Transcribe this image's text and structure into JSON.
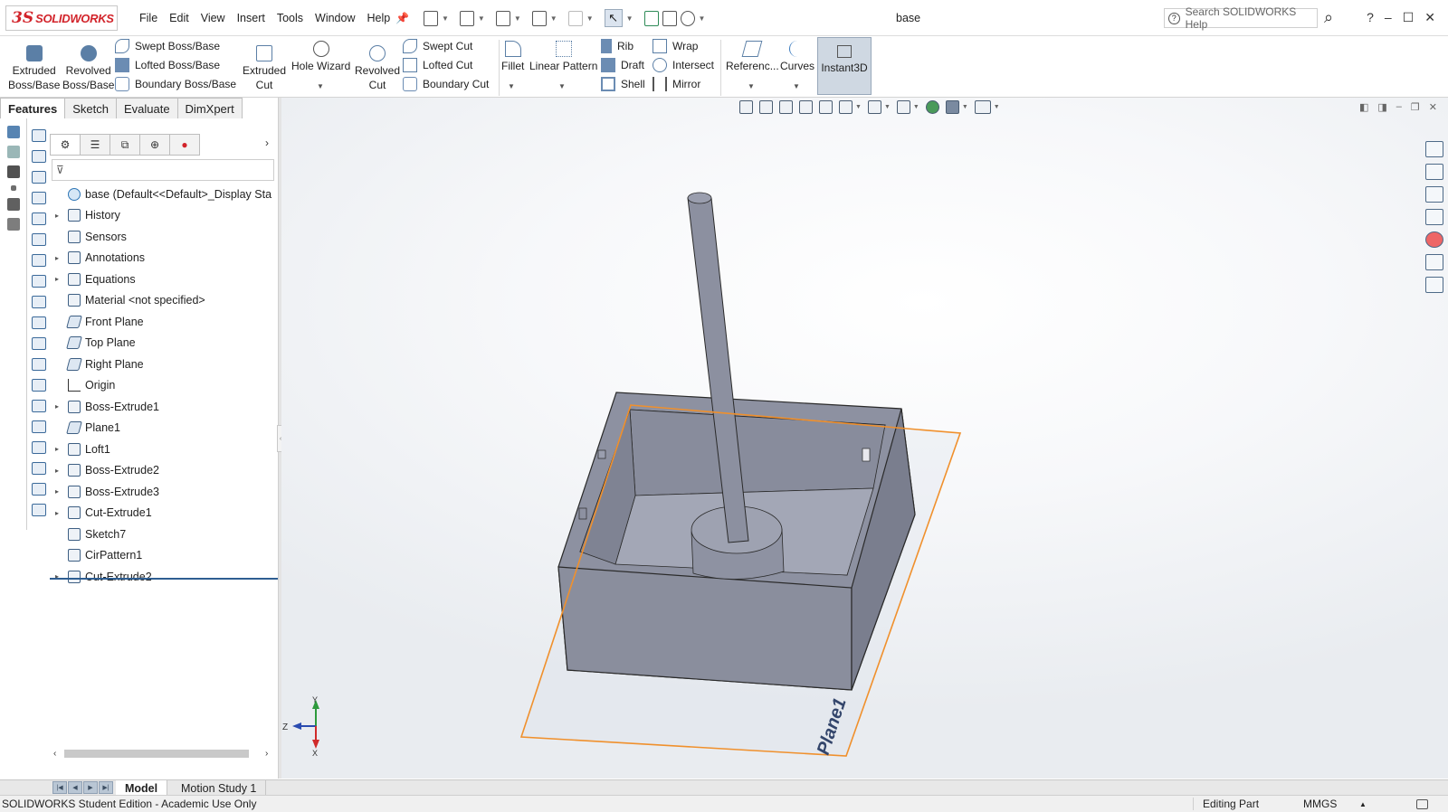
{
  "app": {
    "logo": {
      "mark": "3S",
      "name": "SOLIDWORKS"
    },
    "menu": [
      "File",
      "Edit",
      "View",
      "Insert",
      "Tools",
      "Window",
      "Help"
    ],
    "document_title": "base",
    "help_search_placeholder": "Search SOLIDWORKS Help",
    "help_label": "?",
    "window_controls": [
      "–",
      "☐",
      "✕"
    ]
  },
  "ribbon": {
    "extruded_boss": [
      "Extruded",
      "Boss/Base"
    ],
    "revolved_boss": [
      "Revolved",
      "Boss/Base"
    ],
    "swept_boss": "Swept Boss/Base",
    "lofted_boss": "Lofted Boss/Base",
    "boundary_boss": "Boundary Boss/Base",
    "extruded_cut": [
      "Extruded",
      "Cut"
    ],
    "hole_wizard": "Hole Wizard",
    "revolved_cut": [
      "Revolved",
      "Cut"
    ],
    "swept_cut": "Swept Cut",
    "lofted_cut": "Lofted Cut",
    "boundary_cut": "Boundary Cut",
    "fillet": "Fillet",
    "linear_pattern": "Linear Pattern",
    "rib": "Rib",
    "draft": "Draft",
    "shell": "Shell",
    "wrap": "Wrap",
    "intersect": "Intersect",
    "mirror": "Mirror",
    "reference": "Referenc...",
    "curves": "Curves",
    "instant3d": "Instant3D"
  },
  "command_tabs": [
    "Features",
    "Sketch",
    "Evaluate",
    "DimXpert"
  ],
  "feature_tree": {
    "root": "base  (Default<<Default>_Display Sta",
    "items": [
      {
        "label": "History",
        "expandable": true,
        "icon": "history-icon"
      },
      {
        "label": "Sensors",
        "expandable": false,
        "icon": "sensors-icon"
      },
      {
        "label": "Annotations",
        "expandable": true,
        "icon": "annotations-icon"
      },
      {
        "label": "Equations",
        "expandable": true,
        "icon": "equations-icon"
      },
      {
        "label": "Material <not specified>",
        "expandable": false,
        "icon": "material-icon"
      },
      {
        "label": "Front Plane",
        "expandable": false,
        "icon": "plane-icon"
      },
      {
        "label": "Top Plane",
        "expandable": false,
        "icon": "plane-icon"
      },
      {
        "label": "Right Plane",
        "expandable": false,
        "icon": "plane-icon"
      },
      {
        "label": "Origin",
        "expandable": false,
        "icon": "origin-icon"
      },
      {
        "label": "Boss-Extrude1",
        "expandable": true,
        "icon": "extrude-icon"
      },
      {
        "label": "Plane1",
        "expandable": false,
        "icon": "plane-icon"
      },
      {
        "label": "Loft1",
        "expandable": true,
        "icon": "loft-icon"
      },
      {
        "label": "Boss-Extrude2",
        "expandable": true,
        "icon": "extrude-icon"
      },
      {
        "label": "Boss-Extrude3",
        "expandable": true,
        "icon": "extrude-icon"
      },
      {
        "label": "Cut-Extrude1",
        "expandable": true,
        "icon": "cut-extrude-icon"
      },
      {
        "label": "Sketch7",
        "expandable": false,
        "icon": "sketch-icon"
      },
      {
        "label": "CirPattern1",
        "expandable": false,
        "icon": "circular-pattern-icon"
      },
      {
        "label": "Cut-Extrude2",
        "expandable": true,
        "icon": "cut-extrude-icon"
      }
    ]
  },
  "viewport": {
    "plane_label": "Plane1",
    "triad": {
      "y": "Y",
      "z": "Z",
      "x": "X"
    }
  },
  "bottom_tabs": [
    "Model",
    "Motion Study 1"
  ],
  "status": {
    "left": "SOLIDWORKS Student Edition - Academic Use Only",
    "mode": "Editing Part",
    "units": "MMGS"
  },
  "colors": {
    "brand_red": "#d2232a",
    "model_gray": "#8a8e9e",
    "plane_orange": "#f0902c",
    "rollback_blue": "#2e5e92"
  }
}
